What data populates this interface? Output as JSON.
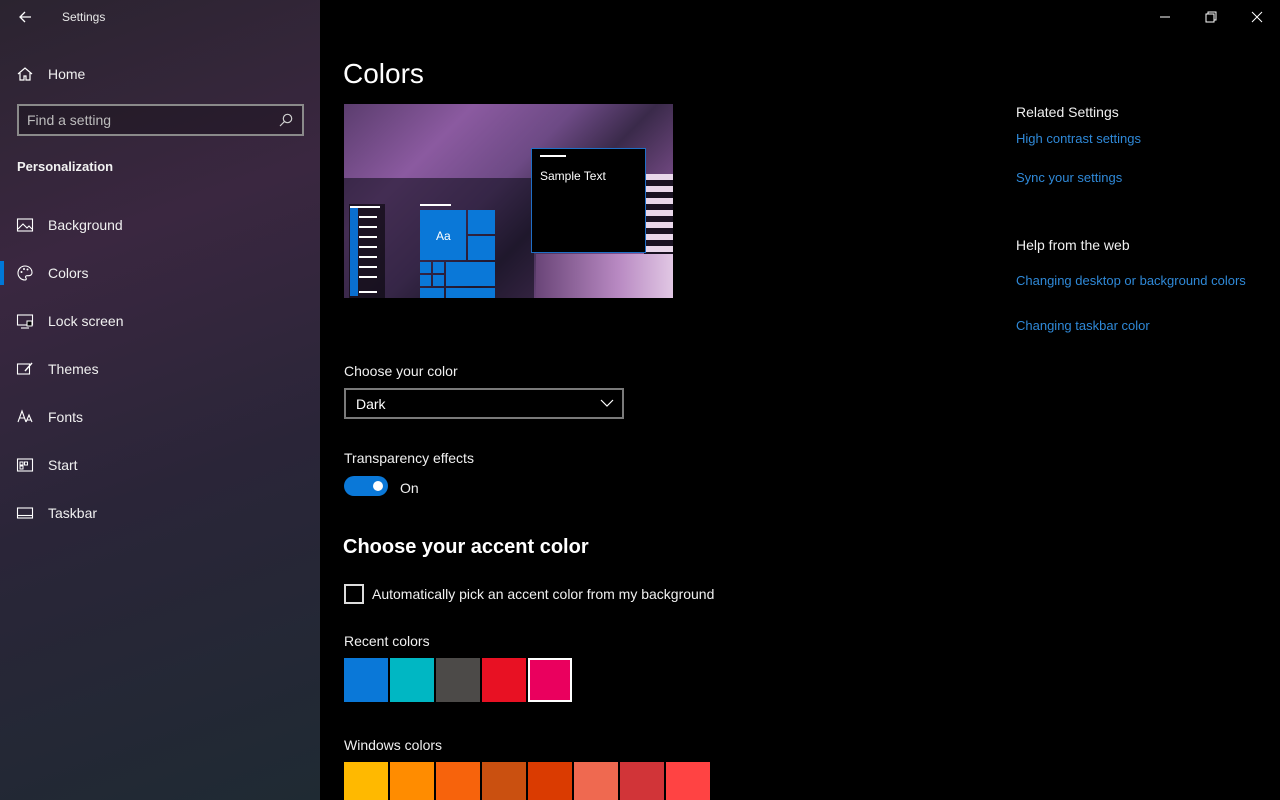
{
  "window": {
    "title": "Settings",
    "controls": [
      "minimize",
      "restore",
      "close"
    ]
  },
  "sidebar": {
    "home_label": "Home",
    "search": {
      "placeholder": "Find a setting",
      "value": ""
    },
    "section_title": "Personalization",
    "items": [
      {
        "label": "Background",
        "icon": "picture-icon",
        "active": false
      },
      {
        "label": "Colors",
        "icon": "palette-icon",
        "active": true
      },
      {
        "label": "Lock screen",
        "icon": "lock-screen-icon",
        "active": false
      },
      {
        "label": "Themes",
        "icon": "themes-icon",
        "active": false
      },
      {
        "label": "Fonts",
        "icon": "fonts-icon",
        "active": false
      },
      {
        "label": "Start",
        "icon": "start-icon",
        "active": false
      },
      {
        "label": "Taskbar",
        "icon": "taskbar-icon",
        "active": false
      }
    ]
  },
  "main": {
    "title": "Colors",
    "preview": {
      "tile_label": "Aa",
      "sample_text": "Sample Text"
    },
    "choose_color": {
      "label": "Choose your color",
      "selected": "Dark"
    },
    "transparency": {
      "label": "Transparency effects",
      "state": "On",
      "enabled": true
    },
    "accent": {
      "title": "Choose your accent color",
      "auto_pick_label": "Automatically pick an accent color from my background",
      "auto_pick_checked": false,
      "recent_label": "Recent colors",
      "recent_colors": [
        "#0a78d8",
        "#00b7c3",
        "#4c4a48",
        "#e81123",
        "#ea005e"
      ],
      "recent_selected_index": 4,
      "windows_label": "Windows colors",
      "windows_colors": [
        "#ffb900",
        "#ff8c00",
        "#f7630c",
        "#ca5010",
        "#da3b01",
        "#ef6950",
        "#d13438",
        "#ff4343"
      ]
    }
  },
  "related": {
    "related_title": "Related Settings",
    "related_links": [
      "High contrast settings",
      "Sync your settings"
    ],
    "help_title": "Help from the web",
    "help_links": [
      "Changing desktop or background colors",
      "Changing taskbar color"
    ]
  },
  "colors": {
    "accent": "#0a78d8",
    "link": "#2f89d8"
  }
}
